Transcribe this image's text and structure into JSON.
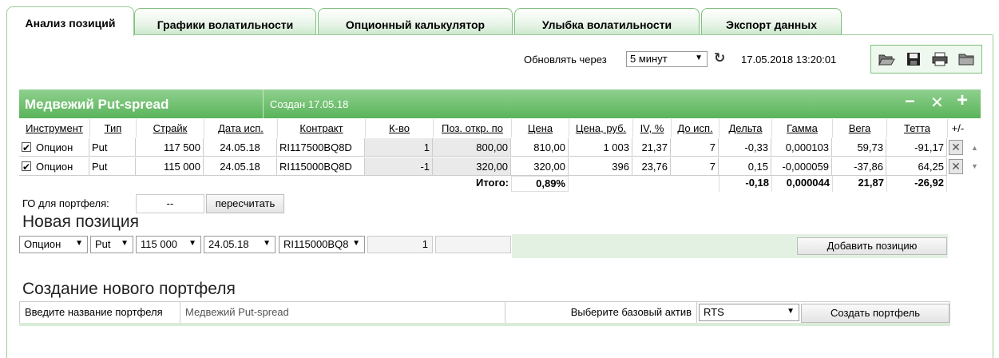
{
  "tabs": [
    {
      "label": "Анализ позиций",
      "active": true
    },
    {
      "label": "Графики волатильности",
      "active": false
    },
    {
      "label": "Опционный калькулятор",
      "active": false
    },
    {
      "label": "Улыбка волатильности",
      "active": false
    },
    {
      "label": "Экспорт данных",
      "active": false
    }
  ],
  "refresh": {
    "label": "Обновлять через",
    "interval": "5 минут",
    "datetime": "17.05.2018 13:20:01"
  },
  "toolbar_icons": [
    "open-folder-icon",
    "save-icon",
    "print-icon",
    "folder-icon"
  ],
  "portfolio_panel": {
    "title": "Медвежий Put-spread",
    "created": "Создан 17.05.18",
    "minus": "−",
    "close": "✕",
    "plus": "+"
  },
  "table": {
    "headers": [
      "Инструмент",
      "Тип",
      "Страйк",
      "Дата исп.",
      "Контракт",
      "К-во",
      "Поз. откр. по",
      "Цена",
      "Цена, руб.",
      "IV, %",
      "До исп.",
      "Дельта",
      "Гамма",
      "Вега",
      "Тетта",
      "+/-"
    ],
    "rows": [
      {
        "instrument": "Опцион",
        "type": "Put",
        "strike": "117 500",
        "date": "24.05.18",
        "contract": "RI117500BQ8D",
        "qty": "1",
        "open": "800,00",
        "price": "810,00",
        "price_rub": "1 003",
        "iv": "21,37",
        "days": "7",
        "delta": "-0,33",
        "gamma": "0,000103",
        "vega": "59,73",
        "theta": "-91,17"
      },
      {
        "instrument": "Опцион",
        "type": "Put",
        "strike": "115 000",
        "date": "24.05.18",
        "contract": "RI115000BQ8D",
        "qty": "-1",
        "open": "320,00",
        "price": "320,00",
        "price_rub": "396",
        "iv": "23,76",
        "days": "7",
        "delta": "0,15",
        "gamma": "-0,000059",
        "vega": "-37,86",
        "theta": "64,25"
      }
    ],
    "totals": {
      "label": "Итого:",
      "pct": "0,89%",
      "delta": "-0,18",
      "gamma": "0,000044",
      "vega": "21,87",
      "theta": "-26,92"
    }
  },
  "go": {
    "label": "ГО для портфеля:",
    "value": "--",
    "recalc": "пересчитать"
  },
  "new_position": {
    "title": "Новая позиция",
    "instrument": "Опцион",
    "type": "Put",
    "strike": "115 000",
    "date": "24.05.18",
    "contract": "RI115000BQ8",
    "qty": "1",
    "add_button": "Добавить позицию"
  },
  "new_portfolio": {
    "title": "Создание нового портфеля",
    "name_label": "Введите название портфеля",
    "name_value": "Медвежий Put-spread",
    "asset_label": "Выберите базовый актив",
    "asset_value": "RTS",
    "create_button": "Создать портфель"
  }
}
